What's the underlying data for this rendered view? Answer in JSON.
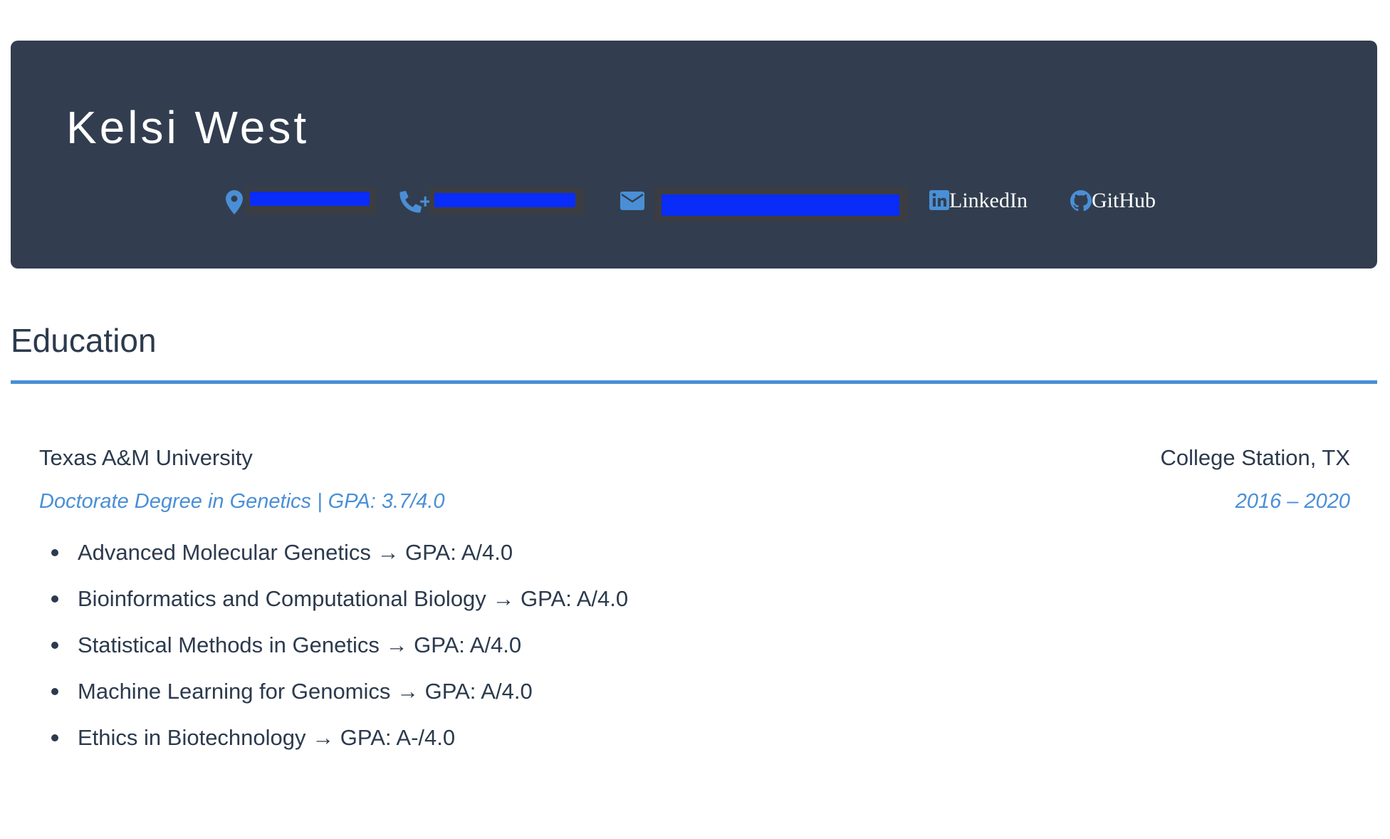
{
  "header": {
    "name": "Kelsi West",
    "contact": {
      "location_icon": "map-pin-icon",
      "phone_icon": "phone-icon",
      "phone_prefix": "+",
      "email_icon": "envelope-icon",
      "linkedin_icon": "linkedin-icon",
      "linkedin_label": "LinkedIn",
      "github_icon": "github-icon",
      "github_label": "GitHub",
      "redaction_color": "#0a2cf9"
    }
  },
  "education": {
    "title": "Education",
    "entries": [
      {
        "school": "Texas A&M University",
        "location": "College Station, TX",
        "degree": "Doctorate Degree in Genetics | GPA: 3.7/4.0",
        "dates": "2016 – 2020",
        "courses": [
          "Advanced Molecular Genetics → GPA: A/4.0",
          "Bioinformatics and Computational Biology → GPA: A/4.0",
          "Statistical Methods in Genetics → GPA: A/4.0",
          "Machine Learning for Genomics → GPA: A/4.0",
          "Ethics in Biotechnology → GPA: A-/4.0"
        ]
      }
    ]
  },
  "colors": {
    "header_bg": "#323e4f",
    "accent": "#4a8fd6",
    "text": "#2c3a4d"
  }
}
